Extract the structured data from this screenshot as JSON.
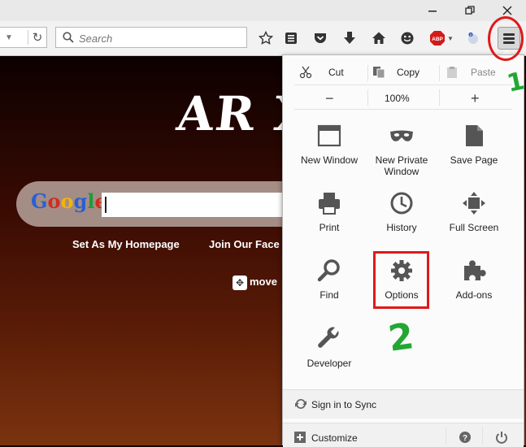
{
  "window": {
    "restore_icon": "restore-icon",
    "close_icon": "close-icon"
  },
  "toolbar": {
    "search_placeholder": "Search",
    "icons": [
      "bookmark-star-icon",
      "reading-list-icon",
      "pocket-icon",
      "download-icon",
      "home-icon",
      "smiley-icon",
      "adblock-plus-icon",
      "extension-icon",
      "hamburger-menu-icon"
    ],
    "abp_label": "ABP"
  },
  "page": {
    "title_text": "AR Xi",
    "search_logo": "Google",
    "links": [
      "Set As My Homepage",
      "Join Our Face"
    ],
    "move_label": "move"
  },
  "menu": {
    "edit": {
      "cut": "Cut",
      "copy": "Copy",
      "paste": "Paste"
    },
    "zoom": {
      "out": "−",
      "value": "100%",
      "in": "+"
    },
    "tiles": [
      {
        "label": "New Window",
        "icon": "new-window-icon"
      },
      {
        "label": "New Private Window",
        "icon": "private-mask-icon"
      },
      {
        "label": "Save Page",
        "icon": "save-page-icon"
      },
      {
        "label": "Print",
        "icon": "printer-icon"
      },
      {
        "label": "History",
        "icon": "history-clock-icon"
      },
      {
        "label": "Full Screen",
        "icon": "full-screen-icon"
      },
      {
        "label": "Find",
        "icon": "magnifier-icon"
      },
      {
        "label": "Options",
        "icon": "gear-icon"
      },
      {
        "label": "Add-ons",
        "icon": "puzzle-piece-icon"
      },
      {
        "label": "Developer",
        "icon": "wrench-icon"
      }
    ],
    "sync": "Sign in to Sync",
    "customize": "Customize"
  },
  "annotations": {
    "step1": "1",
    "step2": "2",
    "color": "#e01919",
    "number_color": "#22a733"
  }
}
